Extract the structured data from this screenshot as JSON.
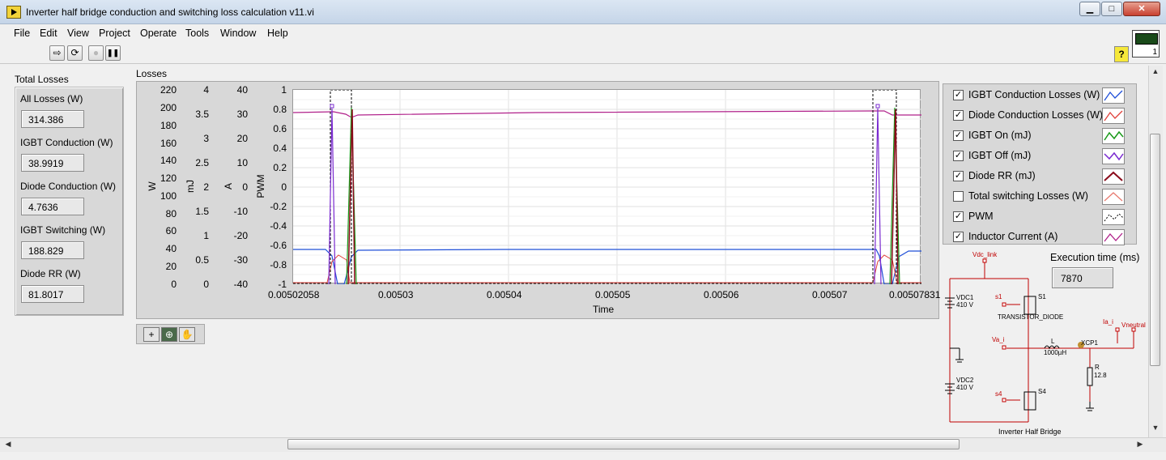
{
  "window": {
    "title": "Inverter half bridge conduction and switching loss calculation v11.vi",
    "minimize": "▁",
    "maximize": "□",
    "close": "✕"
  },
  "menu": [
    "File",
    "Edit",
    "View",
    "Project",
    "Operate",
    "Tools",
    "Window",
    "Help"
  ],
  "toolbar": {
    "run": "⇨",
    "run_continuous": "⟳",
    "abort": "●",
    "pause": "❚❚",
    "help": "?"
  },
  "total_losses": {
    "title": "Total Losses",
    "items": [
      {
        "label": "All Losses (W)",
        "value": "314.386"
      },
      {
        "label": "IGBT Conduction (W)",
        "value": "38.9919"
      },
      {
        "label": "Diode Conduction (W)",
        "value": "4.7636"
      },
      {
        "label": "IGBT Switching (W)",
        "value": "188.829"
      },
      {
        "label": "Diode RR (W)",
        "value": "81.8017"
      }
    ]
  },
  "graph": {
    "title": "Losses",
    "x_title": "Time",
    "x_ticks": [
      "0.00502058",
      "0.00503",
      "0.00504",
      "0.00505",
      "0.00506",
      "0.00507",
      "0.00507831"
    ],
    "axes": [
      {
        "title": "W",
        "ticks": [
          "220",
          "200",
          "180",
          "160",
          "140",
          "120",
          "100",
          "80",
          "60",
          "40",
          "20",
          "0"
        ]
      },
      {
        "title": "mJ",
        "ticks": [
          "4",
          "3.5",
          "3",
          "2.5",
          "2",
          "1.5",
          "1",
          "0.5",
          "0"
        ]
      },
      {
        "title": "A",
        "ticks": [
          "40",
          "30",
          "20",
          "10",
          "0",
          "-10",
          "-20",
          "-30",
          "-40"
        ]
      },
      {
        "title": "PWM",
        "ticks": [
          "1",
          "0.8",
          "0.6",
          "0.4",
          "0.2",
          "0",
          "-0.2",
          "-0.4",
          "-0.6",
          "-0.8",
          "-1"
        ]
      }
    ]
  },
  "legend": [
    {
      "label": "IGBT Conduction Losses (W)",
      "checked": true,
      "color": "#1f4fd8"
    },
    {
      "label": "Diode Conduction Losses (W)",
      "checked": true,
      "color": "#e0403a"
    },
    {
      "label": "IGBT On (mJ)",
      "checked": true,
      "color": "#1a9a1a"
    },
    {
      "label": "IGBT Off (mJ)",
      "checked": true,
      "color": "#7a2ad0"
    },
    {
      "label": "Diode RR (mJ)",
      "checked": true,
      "color": "#8a0a1a"
    },
    {
      "label": "Total switching Losses (W)",
      "checked": false,
      "color": "#e87a70"
    },
    {
      "label": "PWM",
      "checked": true,
      "color": "#000000"
    },
    {
      "label": "Inductor Current (A)",
      "checked": true,
      "color": "#b0208a"
    }
  ],
  "execution": {
    "label": "Execution time (ms)",
    "value": "7870"
  },
  "schematic": {
    "title": "Inverter Half Bridge",
    "labels": {
      "vdc_link": "Vdc_link",
      "vdc1": "VDC1",
      "vdc1_v": "410 V",
      "vdc2": "VDC2",
      "vdc2_v": "410 V",
      "s1_net": "s1",
      "s1": "S1",
      "transistor": "TRANSISTOR_DIODE",
      "va_i": "Va_i",
      "l": "L",
      "l_val": "1000µH",
      "xcp1": "XCP1",
      "ia_i": "Ia_i",
      "vneutral": "Vneutral",
      "r": "R",
      "r_val": "12.8",
      "s4_net": "s4",
      "s4": "S4"
    }
  }
}
